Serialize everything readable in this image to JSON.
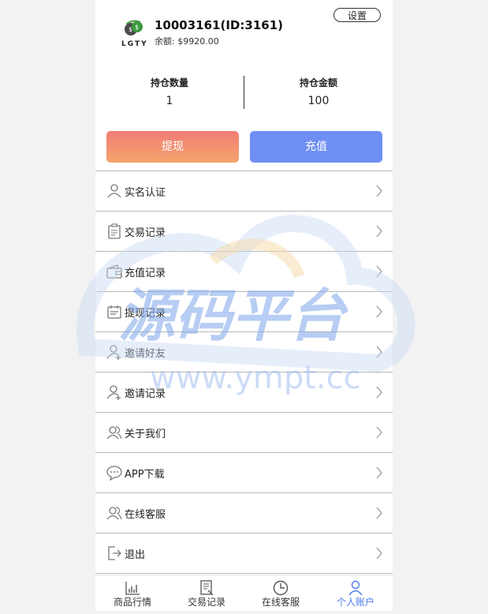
{
  "profile": {
    "logo_text": "LGTY",
    "username": "10003161(ID:3161)",
    "balance": "余额: $9920.00",
    "settings_label": "设置"
  },
  "stats": {
    "holdings_count_label": "持仓数量",
    "holdings_count_value": "1",
    "holdings_amount_label": "持仓金额",
    "holdings_amount_value": "100"
  },
  "actions": {
    "withdraw_label": "提现",
    "recharge_label": "充值"
  },
  "menu": [
    {
      "label": "实名认证",
      "icon": "user-icon"
    },
    {
      "label": "交易记录",
      "icon": "clipboard-icon"
    },
    {
      "label": "充值记录",
      "icon": "wallet-icon"
    },
    {
      "label": "提现记录",
      "icon": "calendar-icon"
    },
    {
      "label": "邀请好友",
      "icon": "user-add-icon"
    },
    {
      "label": "邀请记录",
      "icon": "user-add-icon"
    },
    {
      "label": "关于我们",
      "icon": "users-icon"
    },
    {
      "label": "APP下载",
      "icon": "chat-icon"
    },
    {
      "label": "在线客服",
      "icon": "users-icon"
    },
    {
      "label": "退出",
      "icon": "logout-icon"
    }
  ],
  "tabs": [
    {
      "label": "商品行情",
      "icon": "chart-icon",
      "active": false
    },
    {
      "label": "交易记录",
      "icon": "document-icon",
      "active": false
    },
    {
      "label": "在线客服",
      "icon": "clock-icon",
      "active": false
    },
    {
      "label": "个人账户",
      "icon": "person-icon",
      "active": true
    }
  ],
  "watermark": {
    "title": "源码平台",
    "url": "www.ympt.cc"
  },
  "colors": {
    "withdraw_gradient_top": "#f27d76",
    "withdraw_gradient_bottom": "#f4a46e",
    "recharge": "#6f8ff5",
    "active_tab": "#4a7bf0"
  }
}
